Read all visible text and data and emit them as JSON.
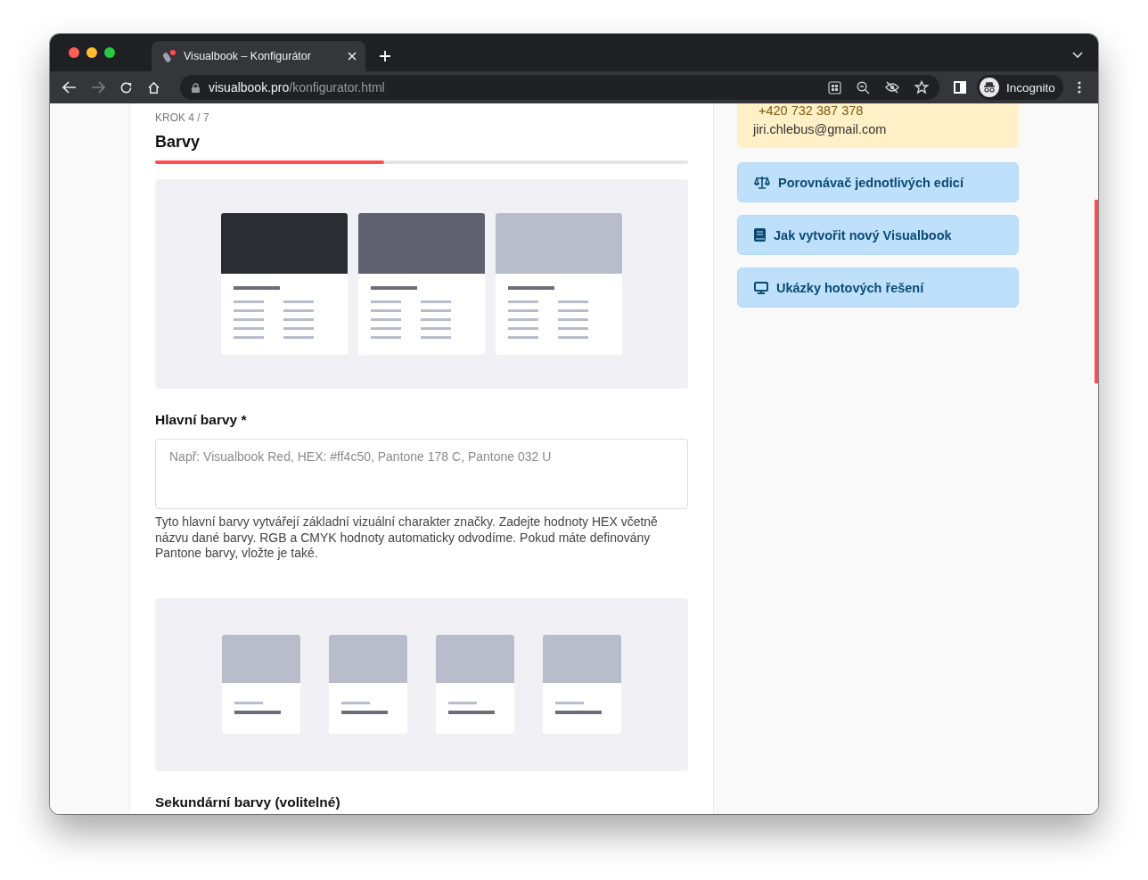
{
  "browser": {
    "tab": {
      "title": "Visualbook – Konfigurátor"
    },
    "address": {
      "host": "visualbook.pro",
      "path": "/konfigurator.html"
    },
    "profile": "Incognito"
  },
  "step": {
    "label": "KROK 4 / 7",
    "title": "Barvy",
    "level": 0.43
  },
  "fields": [
    {
      "label": "Hlavní barvy *",
      "placeholder": "Např: Visualbook Red, HEX: #ff4c50, Pantone 178 C, Pantone 032 U",
      "help": "Tyto hlavní barvy vytvářejí základní vizuální charakter značky. Zadejte hodnoty HEX včetně názvu dané barvy. RGB a CMYK hodnoty automaticky odvodíme. Pokud máte definovány Pantone barvy, vložte je také."
    }
  ],
  "next_section": {
    "title": "Sekundární barvy (volitelné)"
  },
  "contact": {
    "phone": "+420 732 387 378",
    "email": "jiri.chlebus@gmail.com"
  },
  "links": [
    {
      "kind": "scale",
      "label": "Porovnávač jednotlivých edicí"
    },
    {
      "kind": "book",
      "label": "Jak vytvořit nový Visualbook"
    },
    {
      "kind": "monitor",
      "label": "Ukázky hotových řešení"
    }
  ]
}
